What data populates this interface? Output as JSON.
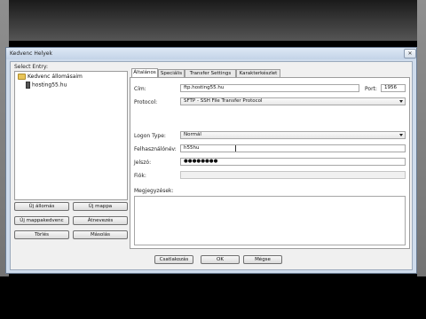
{
  "dialog": {
    "title": "Kedvenc Helyek",
    "close_glyph": "✕",
    "select_entry_label": "Select Entry:",
    "tree": {
      "root": "Kedvenc állomásaim",
      "child": "hosting55.hu"
    },
    "left_buttons": {
      "new_site": "Új állomás",
      "new_folder": "Új mappa",
      "new_bookmark": "Új mappakedvenc",
      "rename": "Átnevezés",
      "delete": "Törlés",
      "copy": "Másolás"
    },
    "tabs": [
      "Általános",
      "Speciális",
      "Transfer Settings",
      "Karakterkészlet"
    ],
    "active_tab": "Általános",
    "form": {
      "host_label": "Cím:",
      "host_value": "ftp.hosting55.hu",
      "port_label": "Port:",
      "port_value": "1956",
      "protocol_label": "Protocol:",
      "protocol_value": "SFTP - SSH File Transfer Protocol",
      "logon_type_label": "Logon Type:",
      "logon_type_value": "Normál",
      "user_label": "Felhasználónév:",
      "user_value": "h55hu",
      "password_label": "Jelszó:",
      "password_value": "●●●●●●●●",
      "account_label": "Fiók:",
      "account_value": "",
      "comments_label": "Megjegyzések:"
    },
    "bottom_buttons": {
      "connect": "Csatlakozás",
      "ok": "OK",
      "cancel": "Mégse"
    }
  }
}
